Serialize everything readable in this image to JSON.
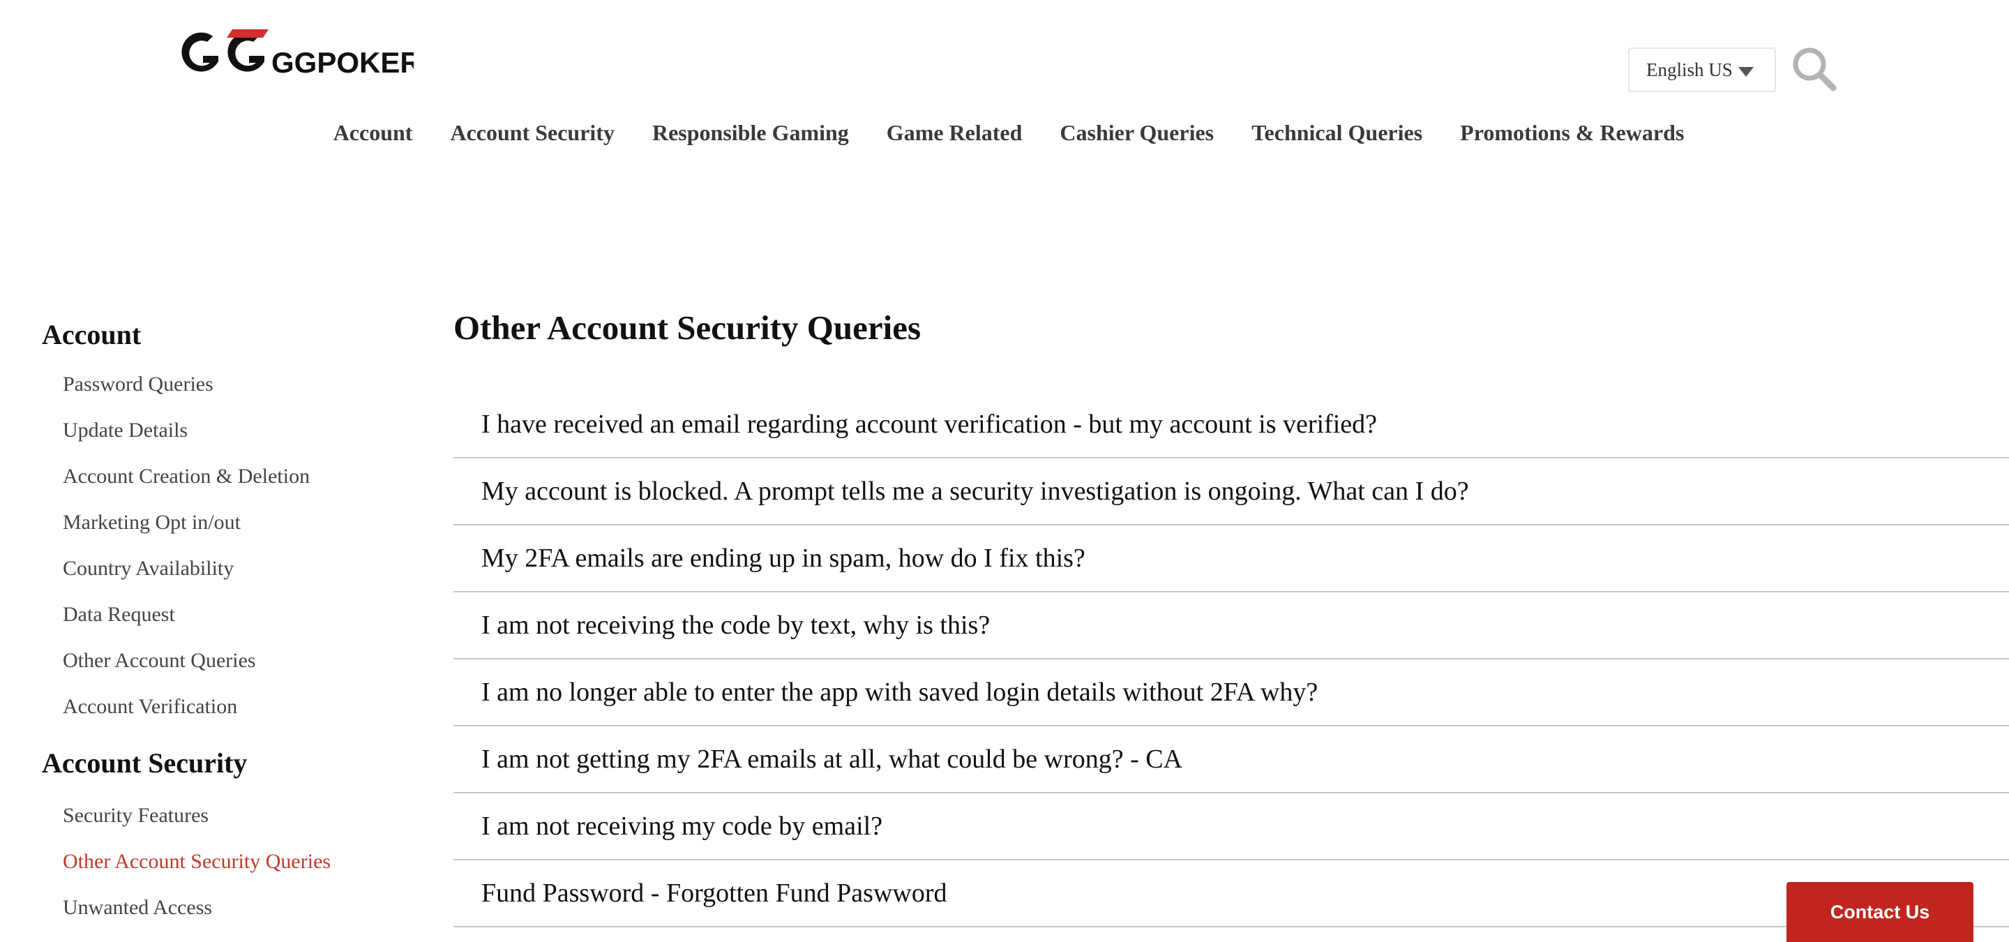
{
  "header": {
    "logo_text": "GGPOKER",
    "language": {
      "selected": "English US"
    },
    "search_icon": "magnifier-icon"
  },
  "nav": {
    "items": [
      {
        "label": "Account"
      },
      {
        "label": "Account Security"
      },
      {
        "label": "Responsible Gaming"
      },
      {
        "label": "Game Related"
      },
      {
        "label": "Cashier Queries"
      },
      {
        "label": "Technical Queries"
      },
      {
        "label": "Promotions & Rewards"
      }
    ]
  },
  "sidebar": {
    "groups": [
      {
        "title": "Account",
        "items": [
          {
            "label": "Password Queries"
          },
          {
            "label": "Update Details"
          },
          {
            "label": "Account Creation & Deletion"
          },
          {
            "label": "Marketing Opt in/out"
          },
          {
            "label": "Country Availability"
          },
          {
            "label": "Data Request"
          },
          {
            "label": "Other Account Queries"
          },
          {
            "label": "Account Verification"
          }
        ]
      },
      {
        "title": "Account Security",
        "items": [
          {
            "label": "Security Features"
          },
          {
            "label": "Other Account Security Queries",
            "active": true
          },
          {
            "label": "Unwanted Access"
          }
        ]
      }
    ]
  },
  "main": {
    "title": "Other Account Security Queries",
    "faqs": [
      {
        "question": "I have received an email regarding account verification - but my account is verified?"
      },
      {
        "question": "My account is blocked. A prompt tells me a security investigation is ongoing. What can I do?"
      },
      {
        "question": "My 2FA emails are ending up in spam, how do I fix this?"
      },
      {
        "question": "I am not receiving the code by text, why is this?"
      },
      {
        "question": "I am no longer able to enter the app with saved login details without 2FA why?"
      },
      {
        "question": "I am not getting my 2FA emails at all, what could be wrong? - CA"
      },
      {
        "question": "I am not receiving my code by email?"
      },
      {
        "question": "Fund Password - Forgotten Fund Paswword"
      }
    ]
  },
  "contact": {
    "label": "Contact Us"
  },
  "colors": {
    "accent": "#c0392b",
    "contact_button": "#c0261e",
    "logo_red": "#d32f2f",
    "divider": "#c8c8c8"
  }
}
